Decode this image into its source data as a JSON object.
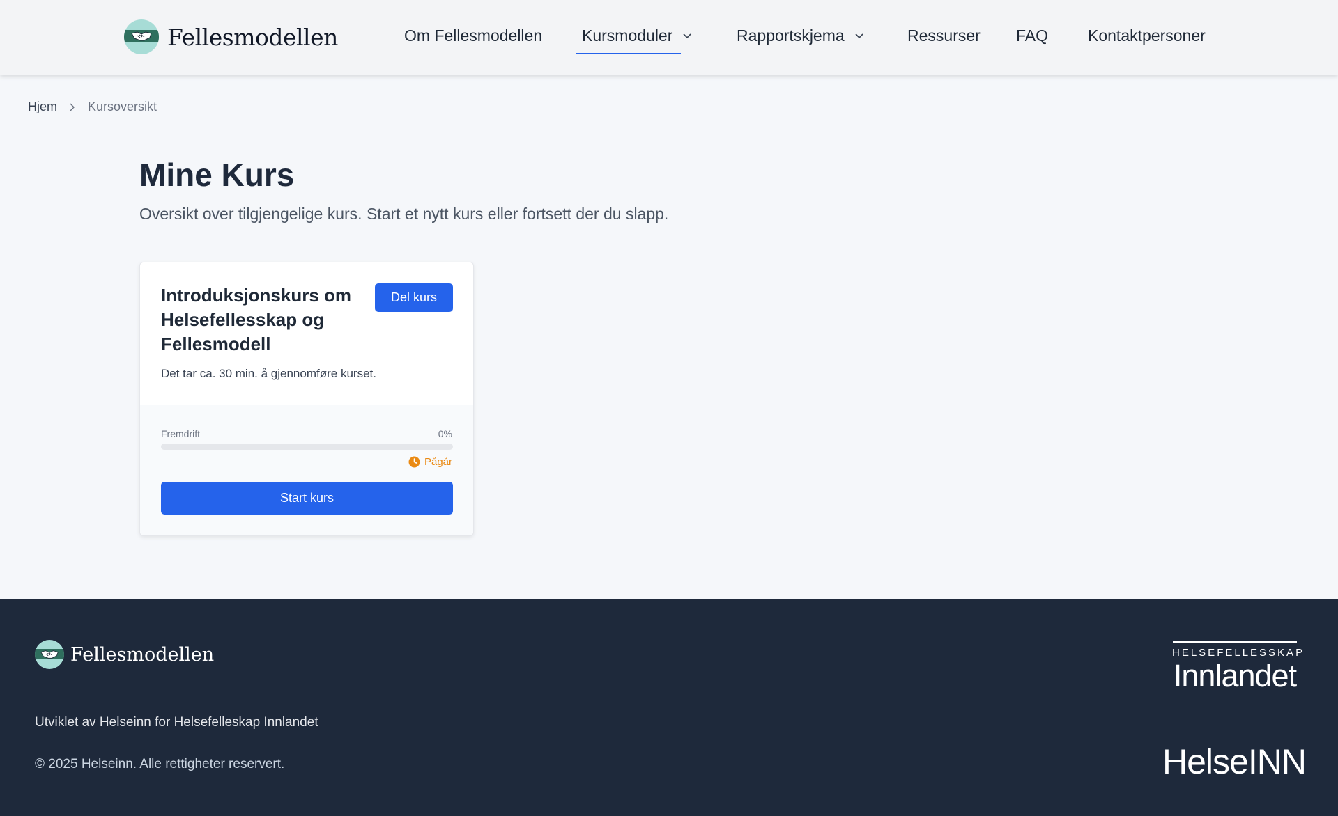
{
  "header": {
    "logo_text": "Fellesmodellen",
    "nav": [
      {
        "label": "Om Fellesmodellen",
        "has_dropdown": false,
        "active": false
      },
      {
        "label": "Kursmoduler",
        "has_dropdown": true,
        "active": true
      },
      {
        "label": "Rapportskjema",
        "has_dropdown": true,
        "active": false
      },
      {
        "label": "Ressurser",
        "has_dropdown": false,
        "active": false
      },
      {
        "label": "FAQ",
        "has_dropdown": false,
        "active": false
      },
      {
        "label": "Kontaktpersoner",
        "has_dropdown": false,
        "active": false
      }
    ]
  },
  "breadcrumb": {
    "home": "Hjem",
    "current": "Kursoversikt"
  },
  "page": {
    "title": "Mine Kurs",
    "subtitle": "Oversikt over tilgjengelige kurs. Start et nytt kurs eller fortsett der du slapp."
  },
  "course": {
    "title": "Introduksjonskurs om Helsefellesskap og Fellesmodell",
    "share_label": "Del kurs",
    "description": "Det tar ca. 30 min. å gjennomføre kurset.",
    "progress_label": "Fremdrift",
    "progress_text": "0%",
    "progress_fraction": 0,
    "status": "Pågår",
    "start_label": "Start kurs"
  },
  "footer": {
    "logo_text": "Fellesmodellen",
    "developed_by": "Utviklet av Helseinn for Helsefelleskap Innlandet",
    "copyright": "© 2025 Helseinn. Alle rettigheter reservert.",
    "partner_top_small": "HELSEFELLESSKAP",
    "partner_top_big": "Innlandet",
    "partner_bottom": "HelseINN"
  },
  "colors": {
    "accent": "#2563eb",
    "footer_bg": "#1e293b",
    "status": "#ea8a14",
    "logo_teal": "#2f6f5e"
  },
  "icons": {
    "logo": "handshake-icon",
    "dropdown": "chevron-down-icon",
    "breadcrumb_separator": "chevron-right-icon",
    "status": "clock-icon"
  }
}
